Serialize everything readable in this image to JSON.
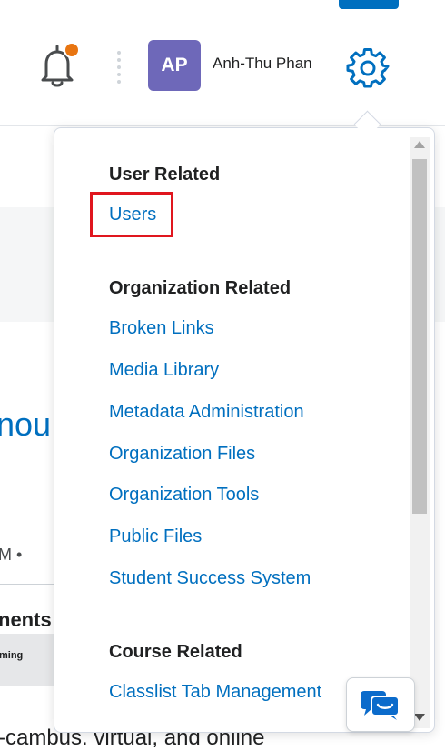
{
  "header": {
    "avatar_initials": "AP",
    "user_name": "Anh-Thu Phan",
    "accent_color": "#006fbf",
    "notification_dot_color": "#e87511",
    "avatar_color": "#6e68b9"
  },
  "background_page": {
    "heading_fragment": "nou",
    "meta_fragment": "M •",
    "section_fragment": "nents",
    "strip_fragment": "ming",
    "body_fragment": "-cambus. virtual, and online"
  },
  "settings_menu": {
    "groups": [
      {
        "title": "User Related",
        "links": [
          "Users"
        ]
      },
      {
        "title": "Organization Related",
        "links": [
          "Broken Links",
          "Media Library",
          "Metadata Administration",
          "Organization Files",
          "Organization Tools",
          "Public Files",
          "Student Success System"
        ]
      },
      {
        "title": "Course Related",
        "links": [
          "Classlist Tab Management"
        ]
      }
    ],
    "highlighted_item": "Users",
    "highlight_color": "#e0161e",
    "link_color": "#006fbf"
  },
  "icons": {
    "notifications": "bell-icon",
    "settings": "gear-icon",
    "chat": "chat-icon"
  }
}
